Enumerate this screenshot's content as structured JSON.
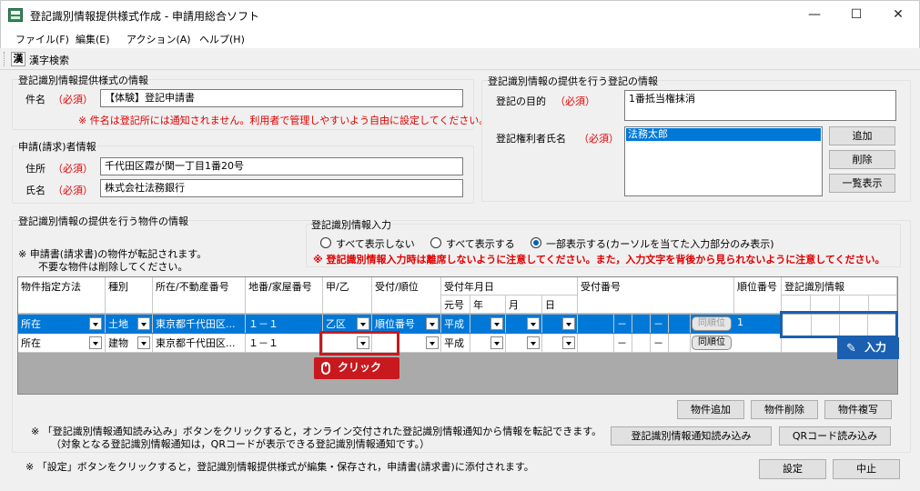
{
  "window": {
    "title": "登記識別情報提供様式作成 - 申請用総合ソフト",
    "minimize": "—",
    "maximize": "☐",
    "close": "✕"
  },
  "menu": [
    "ファイル(F)",
    "編集(E)",
    "アクション(A)",
    "ヘルプ(H)"
  ],
  "toolbar": {
    "kanji_icon": "漢",
    "kanji_search": "漢字検索"
  },
  "form_info": {
    "section_title": "登記識別情報提供様式の情報",
    "name_label": "件名",
    "required": "（必須）",
    "name_value": "【体験】登記申請書",
    "name_note": "※ 件名は登記所には通知されません。利用者で管理しやすいよう自由に設定してください。"
  },
  "applicant": {
    "section_title": "申請(請求)者情報",
    "address_label": "住所",
    "address_value": "千代田区霞が関一丁目1番20号",
    "name_label": "氏名",
    "name_value": "株式会社法務銀行",
    "required": "（必須）"
  },
  "registration": {
    "section_title": "登記識別情報の提供を行う登記の情報",
    "purpose_label": "登記の目的",
    "purpose_value": "1番抵当権抹消",
    "holder_label": "登記権利者氏名",
    "holder_list": [
      "法務太郎"
    ],
    "required": "（必須）",
    "buttons": {
      "add": "追加",
      "delete": "削除",
      "list": "一覧表示"
    }
  },
  "property": {
    "section_title": "登記識別情報の提供を行う物件の情報",
    "note1": "※  申請書(請求書)の物件が転記されます。",
    "note2": "不要な物件は削除してください。"
  },
  "input_mode": {
    "section_title": "登記識別情報入力",
    "options": [
      "すべて表示しない",
      "すべて表示する",
      "一部表示する(カーソルを当てた入力部分のみ表示)"
    ],
    "selected_index": 2,
    "warning": "※  登記識別情報入力時は離席しないように注意してください。また，入力文字を背後から見られないように注意してください。"
  },
  "grid": {
    "headers": {
      "method": "物件指定方法",
      "kind": "種別",
      "location": "所在/不動産番号",
      "lot": "地番/家屋番号",
      "ko_otsu": "甲/乙",
      "reception": "受付/順位",
      "date": "受付年月日",
      "era": "元号",
      "year": "年",
      "month": "月",
      "day": "日",
      "number": "受付番号",
      "rank": "順位番号",
      "id_info": "登記識別情報"
    },
    "rows": [
      {
        "method": "所在",
        "kind": "土地",
        "location": "東京都千代田区...",
        "lot": "１－１",
        "ko_otsu": "乙区",
        "reception": "順位番号",
        "era": "平成",
        "dash1": "－",
        "dash2": "－",
        "same_rank": "同順位",
        "rank": "1"
      },
      {
        "method": "所在",
        "kind": "建物",
        "location": "東京都千代田区...",
        "lot": "１－１",
        "ko_otsu": "",
        "reception": "",
        "era": "平成",
        "dash1": "－",
        "dash2": "－",
        "same_rank": "同順位",
        "rank": ""
      }
    ]
  },
  "callouts": {
    "click": "クリック",
    "input": "入力"
  },
  "actions": {
    "add_property": "物件追加",
    "delete_property": "物件削除",
    "copy_property": "物件複写",
    "read_notice": "登記識別情報通知読み込み",
    "read_qr": "QRコード読み込み",
    "note_read1": "※ 「登記識別情報通知読み込み」ボタンをクリックすると，オンライン交付された登記識別情報通知から情報を転記できます。",
    "note_read2": "（対象となる登記識別情報通知は，QRコードが表示できる登記識別情報通知です。）",
    "note_settings": "※ 「設定」ボタンをクリックすると，登記識別情報提供様式が編集・保存され，申請書(請求書)に添付されます。",
    "settings": "設定",
    "cancel": "中止"
  },
  "colors": {
    "accent_blue": "#0078d7",
    "warning_red": "#e00000",
    "callout_red": "#c8191e",
    "callout_blue": "#1b5fb0"
  }
}
